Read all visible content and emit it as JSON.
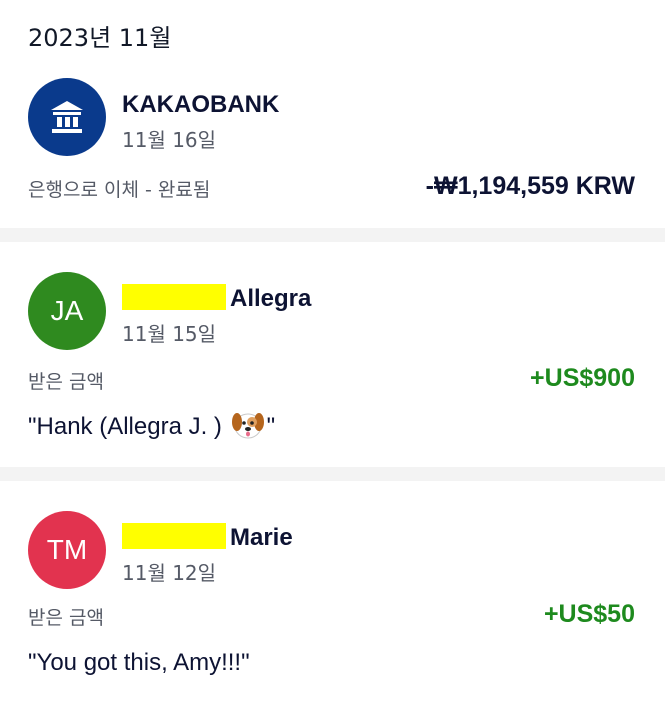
{
  "month_header": "2023년 11월",
  "transactions": [
    {
      "avatar_type": "bank-icon",
      "avatar_color": "#0a3a8c",
      "name": "KAKAOBANK",
      "date": "11월 16일",
      "status": "은행으로 이체 - 완료됨",
      "amount": "-₩1,194,559 KRW",
      "amount_color": "#0d1333"
    },
    {
      "avatar_initials": "JA",
      "avatar_color": "#2f8a1f",
      "name_visible": "Allegra",
      "name_redacted": true,
      "date": "11월 15일",
      "status": "받은 금액",
      "amount": "+US$900",
      "amount_color": "#1e8a1e",
      "note_text": "\"Hank (Allegra J.  )",
      "note_emoji": "dog-face-icon",
      "note_end": "\""
    },
    {
      "avatar_initials": "TM",
      "avatar_color": "#e2334f",
      "name_visible": "Marie",
      "name_redacted": true,
      "date": "11월 12일",
      "status": "받은 금액",
      "amount": "+US$50",
      "amount_color": "#1e8a1e",
      "note_text": "\"You got this, Amy!!!\""
    }
  ]
}
